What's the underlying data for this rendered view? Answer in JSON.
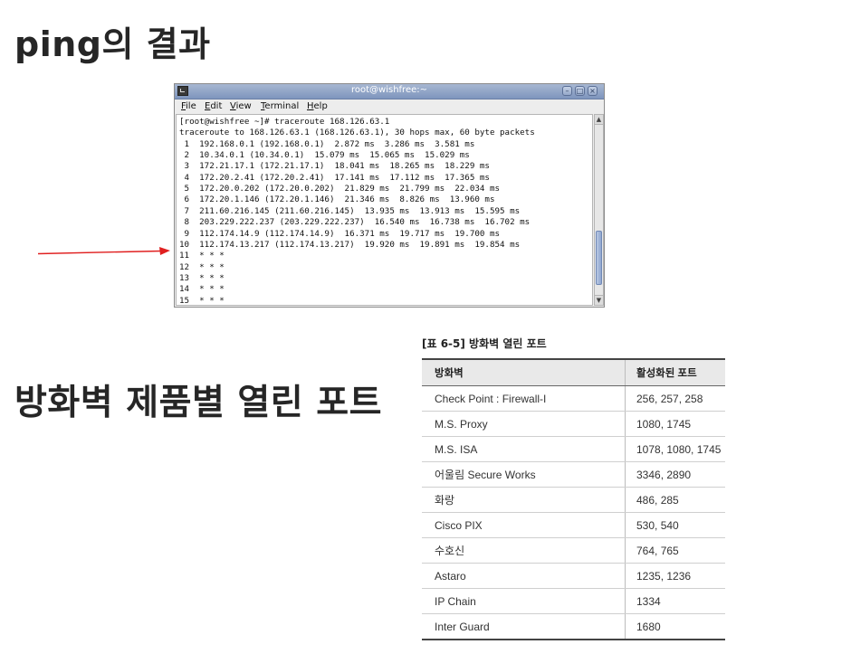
{
  "slide": {
    "title1": "ping의 결과",
    "title2": "방화벽 제품별 열린 포트"
  },
  "terminal": {
    "title": "root@wishfree:~",
    "menu": [
      "File",
      "Edit",
      "View",
      "Terminal",
      "Help"
    ],
    "lines": [
      "[root@wishfree ~]# traceroute 168.126.63.1",
      "traceroute to 168.126.63.1 (168.126.63.1), 30 hops max, 60 byte packets",
      " 1  192.168.0.1 (192.168.0.1)  2.872 ms  3.286 ms  3.581 ms",
      " 2  10.34.0.1 (10.34.0.1)  15.079 ms  15.065 ms  15.029 ms",
      " 3  172.21.17.1 (172.21.17.1)  18.041 ms  18.265 ms  18.229 ms",
      " 4  172.20.2.41 (172.20.2.41)  17.141 ms  17.112 ms  17.365 ms",
      " 5  172.20.0.202 (172.20.0.202)  21.829 ms  21.799 ms  22.034 ms",
      " 6  172.20.1.146 (172.20.1.146)  21.346 ms  8.826 ms  13.960 ms",
      " 7  211.60.216.145 (211.60.216.145)  13.935 ms  13.913 ms  15.595 ms",
      " 8  203.229.222.237 (203.229.222.237)  16.540 ms  16.738 ms  16.702 ms",
      " 9  112.174.14.9 (112.174.14.9)  16.371 ms  19.717 ms  19.700 ms",
      "10  112.174.13.217 (112.174.13.217)  19.920 ms  19.891 ms  19.854 ms",
      "11  * * *",
      "12  * * *",
      "13  * * *",
      "14  * * *",
      "15  * * *"
    ]
  },
  "arrow": {
    "color": "#e02020"
  },
  "table": {
    "caption": "[표 6-5] 방화벽 열린 포트",
    "headers": [
      "방화벽",
      "활성화된 포트"
    ],
    "rows": [
      [
        "Check Point : Firewall-I",
        "256, 257, 258"
      ],
      [
        "M.S. Proxy",
        "1080, 1745"
      ],
      [
        "M.S. ISA",
        "1078, 1080, 1745"
      ],
      [
        "어울림 Secure Works",
        "3346, 2890"
      ],
      [
        "화랑",
        "486, 285"
      ],
      [
        "Cisco PIX",
        "530, 540"
      ],
      [
        "수호신",
        "764, 765"
      ],
      [
        "Astaro",
        "1235, 1236"
      ],
      [
        "IP Chain",
        "1334"
      ],
      [
        "Inter Guard",
        "1680"
      ]
    ]
  }
}
